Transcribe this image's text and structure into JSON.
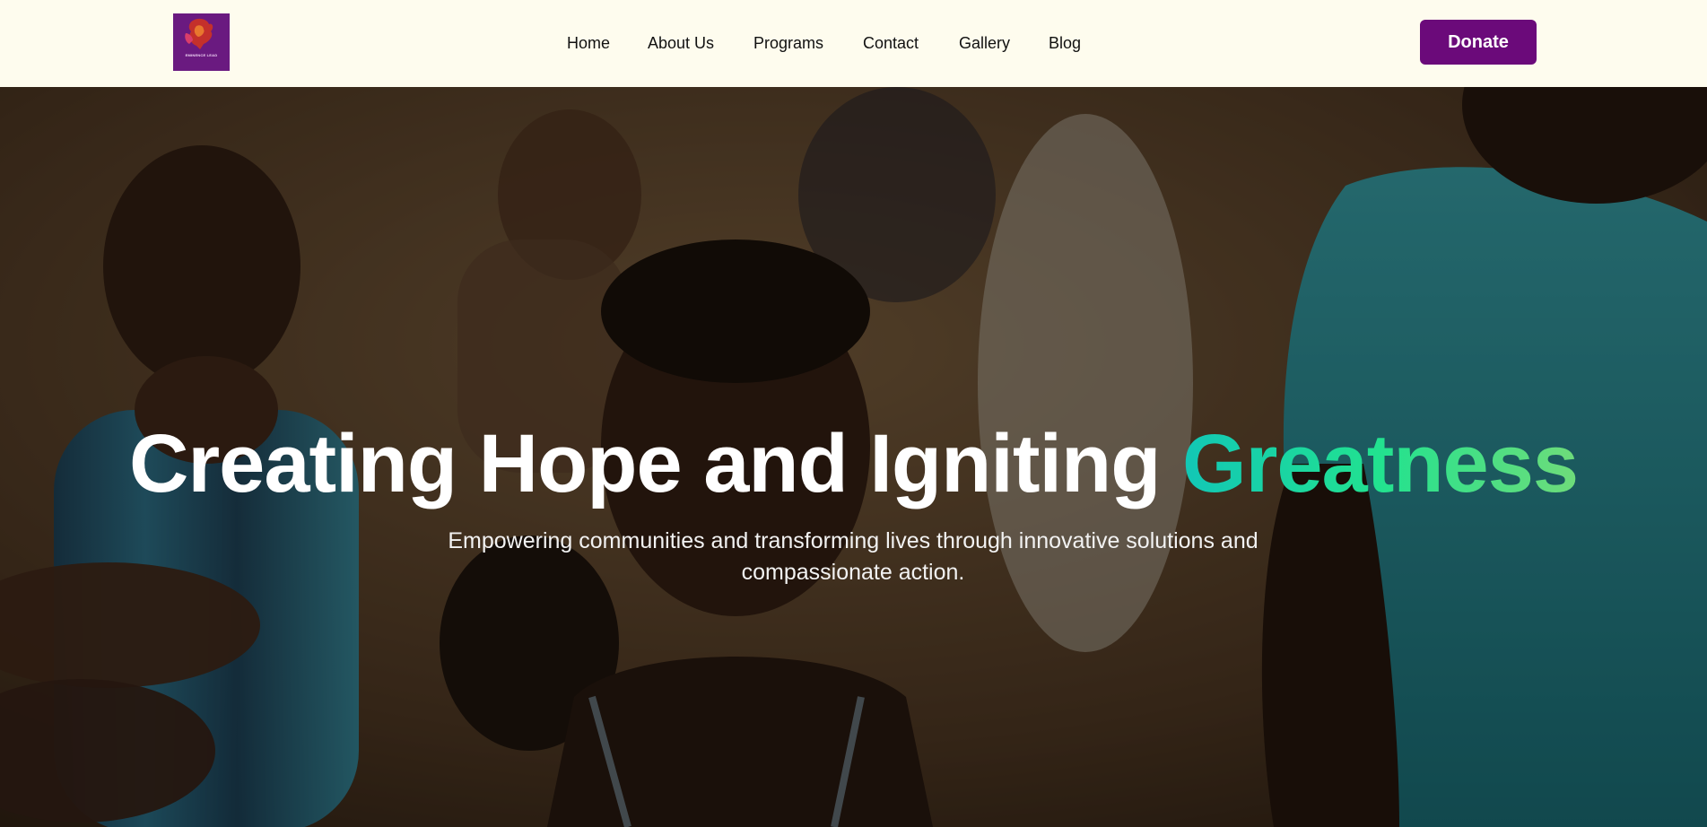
{
  "header": {
    "logo": {
      "icon": "flame-hand-logo-icon",
      "text": "EMINENCE LEAD",
      "background": "#6a1a80"
    },
    "nav": [
      "Home",
      "About Us",
      "Programs",
      "Contact",
      "Gallery",
      "Blog"
    ],
    "donate_label": "Donate",
    "background": "#fefcee",
    "accent": "#6b0a7a"
  },
  "hero": {
    "title_main": "Creating Hope and Igniting ",
    "title_accent": "Greatness",
    "subtitle": "Empowering communities and transforming lives through innovative solutions and compassionate action.",
    "accent_gradient": [
      "#12c7b6",
      "#22e28f",
      "#6fdc7a"
    ],
    "background_image": "children-photo"
  }
}
